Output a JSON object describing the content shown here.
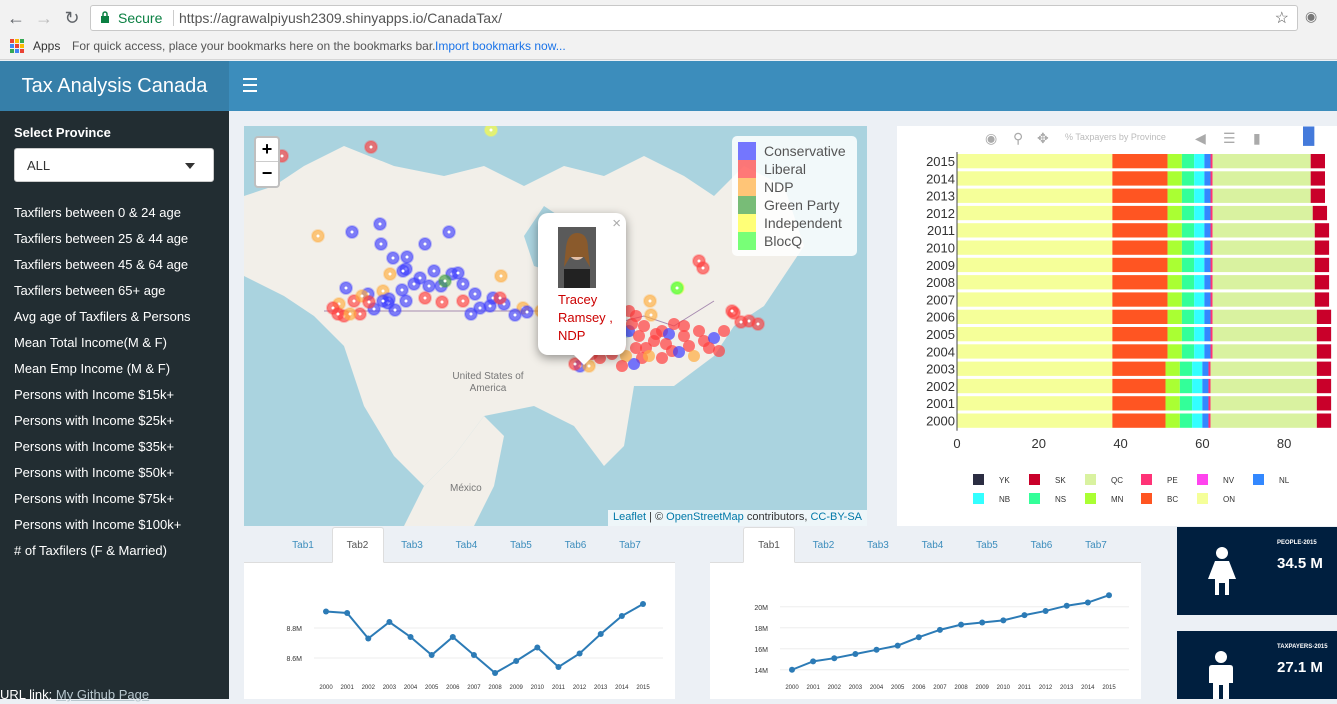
{
  "browser": {
    "secure_label": "Secure",
    "url": "https://agrawalpiyush2309.shinyapps.io/CanadaTax/",
    "bookmarks_apps": "Apps",
    "bookmarks_hint": "For quick access, place your bookmarks here on the bookmarks bar.",
    "bookmarks_import": "Import bookmarks now..."
  },
  "app": {
    "title": "Tax Analysis Canada"
  },
  "sidebar": {
    "select_label": "Select Province",
    "select_value": "ALL",
    "items": [
      "Taxfilers between 0 & 24 age",
      "Taxfilers between 25 & 44 age",
      "Taxfilers between 45 & 64 age",
      "Taxfilers between 65+ age",
      "Avg age of Taxfilers & Persons",
      "Mean Total Income(M & F)",
      "Mean Emp Income (M & F)",
      "Persons with Income $15k+",
      "Persons with Income $25k+",
      "Persons with Income $35k+",
      "Persons with Income $50k+",
      "Persons with Income $75k+",
      "Persons with Income $100k+",
      "# of Taxfilers (F & Married)"
    ],
    "github_prefix": "URL link:",
    "github_link": "My Github Page"
  },
  "map": {
    "legend": [
      {
        "label": "Conservative",
        "color": "#3f3fff"
      },
      {
        "label": "Liberal",
        "color": "#ff3f3f"
      },
      {
        "label": "NDP",
        "color": "#ffad3f"
      },
      {
        "label": "Green Party",
        "color": "#3f9f3f"
      },
      {
        "label": "Independent",
        "color": "#ffff3f"
      },
      {
        "label": "BlocQ",
        "color": "#3fff3f"
      }
    ],
    "popup_text": "Tracey Ramsey , NDP",
    "label_us": "United States of America",
    "label_mexico": "México",
    "attrib_leaflet": "Leaflet",
    "attrib_mid": "| © ",
    "attrib_osm": "OpenStreetMap",
    "attrib_contrib": " contributors, ",
    "attrib_license": "CC-BY-SA",
    "zoom_in": "+",
    "zoom_out": "−"
  },
  "bar_chart": {
    "modebar_hint": "% Taxpayers by Province",
    "years": [
      "2015",
      "2014",
      "2013",
      "2012",
      "2011",
      "2010",
      "2009",
      "2008",
      "2007",
      "2006",
      "2005",
      "2004",
      "2003",
      "2002",
      "2001",
      "2000"
    ],
    "x_ticks": [
      "0",
      "20",
      "40",
      "60",
      "80"
    ],
    "legend": [
      {
        "code": "YK",
        "color": "#2b2d42"
      },
      {
        "code": "SK",
        "color": "#c9002a"
      },
      {
        "code": "QC",
        "color": "#d9f2a0"
      },
      {
        "code": "PE",
        "color": "#ff3377"
      },
      {
        "code": "NV",
        "color": "#ff44ee"
      },
      {
        "code": "NL",
        "color": "#3388ff"
      },
      {
        "code": "NB",
        "color": "#33ffff"
      },
      {
        "code": "NS",
        "color": "#33ff99"
      },
      {
        "code": "MN",
        "color": "#aaff33"
      },
      {
        "code": "BC",
        "color": "#ff5522"
      },
      {
        "code": "ON",
        "color": "#f5ff99"
      }
    ]
  },
  "tabs_left": {
    "items": [
      "Tab1",
      "Tab2",
      "Tab3",
      "Tab4",
      "Tab5",
      "Tab6",
      "Tab7"
    ],
    "active": 1
  },
  "tabs_right": {
    "items": [
      "Tab1",
      "Tab2",
      "Tab3",
      "Tab4",
      "Tab5",
      "Tab6",
      "Tab7"
    ],
    "active": 0
  },
  "line_left": {
    "y_ticks": [
      "8.8M",
      "8.6M"
    ],
    "x_labels": [
      "2000",
      "2001",
      "2002",
      "2003",
      "2004",
      "2005",
      "2006",
      "2007",
      "2008",
      "2009",
      "2010",
      "2011",
      "2012",
      "2013",
      "2014",
      "2015"
    ]
  },
  "line_right": {
    "y_ticks": [
      "20M",
      "18M",
      "16M",
      "14M"
    ],
    "x_labels": [
      "2000",
      "2001",
      "2002",
      "2003",
      "2004",
      "2005",
      "2006",
      "2007",
      "2008",
      "2009",
      "2010",
      "2011",
      "2012",
      "2013",
      "2014",
      "2015"
    ]
  },
  "chart_data": [
    {
      "type": "bar",
      "title": "",
      "orientation": "horizontal-stacked",
      "categories": [
        "2015",
        "2014",
        "2013",
        "2012",
        "2011",
        "2010",
        "2009",
        "2008",
        "2007",
        "2006",
        "2005",
        "2004",
        "2003",
        "2002",
        "2001",
        "2000"
      ],
      "xlim": [
        0,
        90
      ],
      "series": [
        {
          "name": "ON",
          "values": [
            38,
            38,
            38,
            38,
            38,
            38,
            38,
            38,
            38,
            38,
            38,
            38,
            38,
            38,
            38,
            38
          ]
        },
        {
          "name": "BC",
          "values": [
            13.5,
            13.5,
            13.5,
            13.5,
            13.5,
            13.5,
            13.5,
            13.5,
            13.5,
            13.5,
            13.5,
            13.5,
            13,
            13,
            13,
            13
          ]
        },
        {
          "name": "MN",
          "values": [
            3.5,
            3.5,
            3.5,
            3.5,
            3.5,
            3.5,
            3.5,
            3.5,
            3.5,
            3.5,
            3.5,
            3.5,
            3.5,
            3.5,
            3.5,
            3.5
          ]
        },
        {
          "name": "NS",
          "values": [
            3,
            3,
            3,
            3,
            3,
            3,
            3,
            3,
            3,
            3,
            3,
            3,
            3,
            3,
            3,
            3
          ]
        },
        {
          "name": "NB",
          "values": [
            2.5,
            2.5,
            2.5,
            2.5,
            2.5,
            2.5,
            2.5,
            2.5,
            2.5,
            2.5,
            2.5,
            2.5,
            2.5,
            2.5,
            2.5,
            2.5
          ]
        },
        {
          "name": "NL",
          "values": [
            1.5,
            1.5,
            1.5,
            1.5,
            1.5,
            1.5,
            1.5,
            1.5,
            1.5,
            1.5,
            1.5,
            1.5,
            1.5,
            1.5,
            1.5,
            1.5
          ]
        },
        {
          "name": "PE",
          "values": [
            0.5,
            0.5,
            0.5,
            0.5,
            0.5,
            0.5,
            0.5,
            0.5,
            0.5,
            0.5,
            0.5,
            0.5,
            0.5,
            0.5,
            0.5,
            0.5
          ]
        },
        {
          "name": "QC",
          "values": [
            24,
            24,
            24,
            24.5,
            25,
            25,
            25,
            25,
            25,
            25.5,
            25.5,
            25.5,
            26,
            26,
            26,
            26
          ]
        },
        {
          "name": "SK",
          "values": [
            3.5,
            3.5,
            3.5,
            3.5,
            3.5,
            3.5,
            3.5,
            3.5,
            3.5,
            3.5,
            3.5,
            3.5,
            3.5,
            3.5,
            3.5,
            3.5
          ]
        }
      ]
    },
    {
      "type": "line",
      "x": [
        "2000",
        "2001",
        "2002",
        "2003",
        "2004",
        "2005",
        "2006",
        "2007",
        "2008",
        "2009",
        "2010",
        "2011",
        "2012",
        "2013",
        "2014",
        "2015"
      ],
      "series": [
        {
          "values": [
            8.91,
            8.9,
            8.73,
            8.84,
            8.74,
            8.62,
            8.74,
            8.62,
            8.5,
            8.58,
            8.67,
            8.54,
            8.63,
            8.76,
            8.88,
            8.96
          ]
        }
      ],
      "ylim": [
        8.5,
        9.0
      ]
    },
    {
      "type": "line",
      "x": [
        "2000",
        "2001",
        "2002",
        "2003",
        "2004",
        "2005",
        "2006",
        "2007",
        "2008",
        "2009",
        "2010",
        "2011",
        "2012",
        "2013",
        "2014",
        "2015"
      ],
      "series": [
        {
          "values": [
            14.0,
            14.8,
            15.1,
            15.5,
            15.9,
            16.3,
            17.1,
            17.8,
            18.3,
            18.5,
            18.7,
            19.2,
            19.6,
            20.1,
            20.4,
            21.1
          ]
        }
      ],
      "ylim": [
        13.5,
        21.5
      ]
    }
  ],
  "infoboxes": [
    {
      "label": "PEOPLE-2015",
      "value": "34.5 M"
    },
    {
      "label": "TAXPAYERS-2015",
      "value": "27.1 M"
    }
  ]
}
